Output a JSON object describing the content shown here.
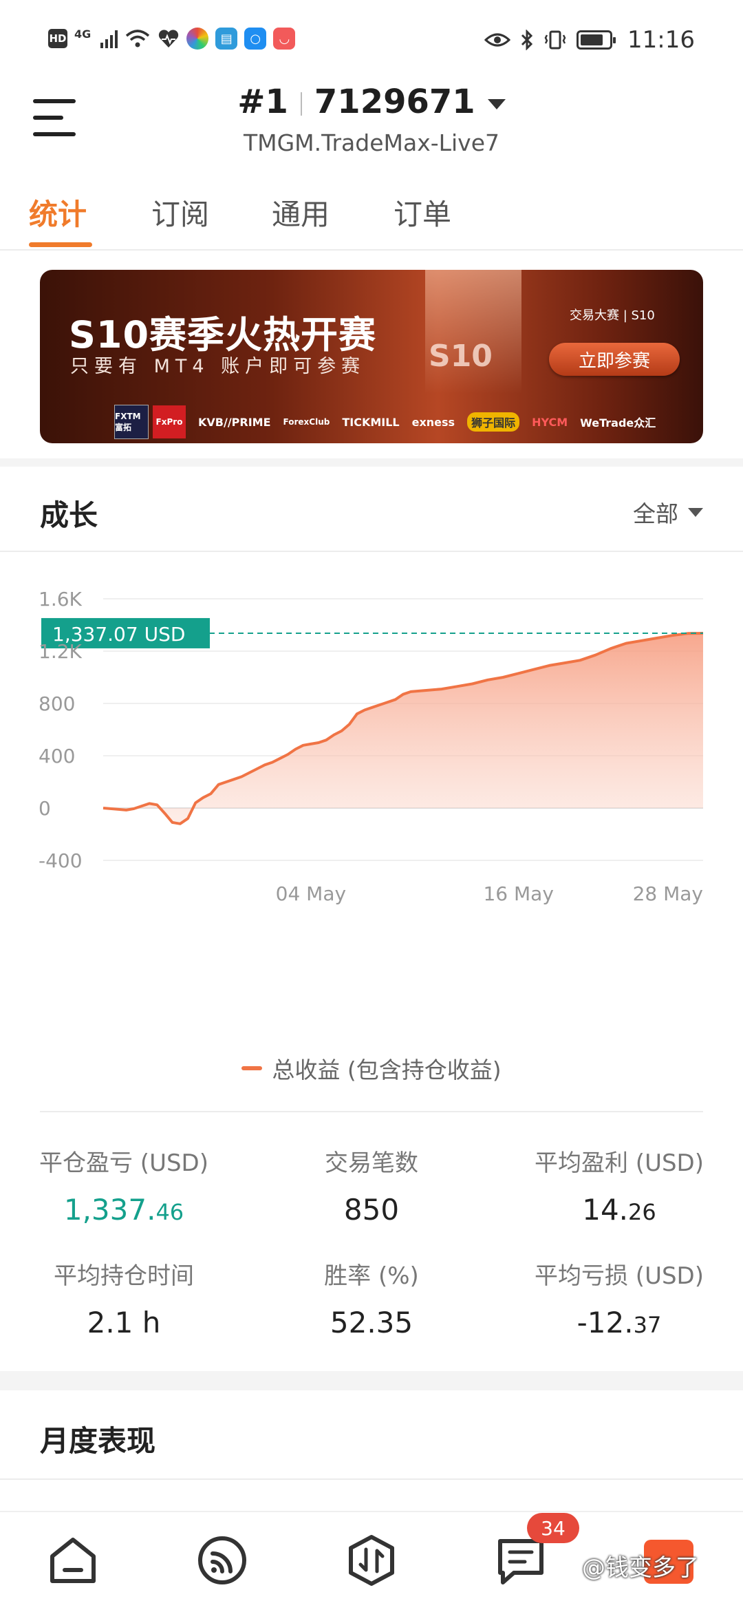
{
  "status_bar": {
    "hd": "HD",
    "network": "4G",
    "time": "11:16"
  },
  "header": {
    "account_rank": "#1",
    "account_id": "7129671",
    "server": "TMGM.TradeMax-Live7"
  },
  "tabs": [
    {
      "label": "统计",
      "active": true
    },
    {
      "label": "订阅",
      "active": false
    },
    {
      "label": "通用",
      "active": false
    },
    {
      "label": "订单",
      "active": false
    }
  ],
  "banner": {
    "title": "S10赛季火热开赛",
    "subtitle": "只要有 MT4 账户即可参赛",
    "season_mark": "S10",
    "brand": "交易大赛 | S10",
    "cta_label": "立即参赛",
    "sponsors": [
      "FXTM 富拓",
      "FxPro",
      "KVB//PRIME",
      "ForexClub",
      "TICKMILL",
      "exness",
      "狮子国际",
      "HYCM",
      "WeTrade众汇"
    ]
  },
  "growth": {
    "title": "成长",
    "range_filter": "全部",
    "current_value_label": "1,337.07 USD",
    "legend_label": "总收益 (包含持仓收益)"
  },
  "chart_data": {
    "type": "area",
    "y_ticks": [
      "1.6K",
      "1.2K",
      "800",
      "400",
      "0",
      "-400"
    ],
    "x_ticks": [
      "04 May",
      "16 May",
      "28 May"
    ],
    "ylim": [
      -400,
      1600
    ],
    "current_value": 1337.07,
    "series": [
      {
        "name": "总收益 (包含持仓收益)",
        "color": "#f07445",
        "points": [
          [
            0,
            0
          ],
          [
            2,
            -10
          ],
          [
            3,
            -15
          ],
          [
            4,
            -5
          ],
          [
            5,
            15
          ],
          [
            6,
            35
          ],
          [
            7,
            25
          ],
          [
            8,
            -40
          ],
          [
            9,
            -110
          ],
          [
            10,
            -120
          ],
          [
            11,
            -80
          ],
          [
            12,
            40
          ],
          [
            13,
            80
          ],
          [
            14,
            110
          ],
          [
            15,
            180
          ],
          [
            16,
            200
          ],
          [
            17,
            220
          ],
          [
            18,
            240
          ],
          [
            20,
            300
          ],
          [
            21,
            330
          ],
          [
            22,
            350
          ],
          [
            23,
            380
          ],
          [
            24,
            410
          ],
          [
            25,
            450
          ],
          [
            26,
            480
          ],
          [
            27,
            490
          ],
          [
            28,
            500
          ],
          [
            29,
            520
          ],
          [
            30,
            560
          ],
          [
            31,
            590
          ],
          [
            32,
            640
          ],
          [
            33,
            720
          ],
          [
            34,
            750
          ],
          [
            35,
            770
          ],
          [
            36,
            790
          ],
          [
            37,
            810
          ],
          [
            38,
            830
          ],
          [
            39,
            870
          ],
          [
            40,
            890
          ],
          [
            42,
            900
          ],
          [
            44,
            910
          ],
          [
            46,
            930
          ],
          [
            48,
            950
          ],
          [
            50,
            980
          ],
          [
            52,
            1000
          ],
          [
            54,
            1030
          ],
          [
            56,
            1060
          ],
          [
            58,
            1090
          ],
          [
            60,
            1110
          ],
          [
            62,
            1130
          ],
          [
            64,
            1170
          ],
          [
            66,
            1220
          ],
          [
            68,
            1260
          ],
          [
            70,
            1280
          ],
          [
            72,
            1300
          ],
          [
            74,
            1320
          ],
          [
            76,
            1335
          ],
          [
            78,
            1337.07
          ]
        ]
      }
    ],
    "x_range_days": [
      0,
      78
    ]
  },
  "stats": [
    {
      "label": "平仓盈亏 (USD)",
      "main": "1,337.",
      "fraction": "46",
      "positive": true
    },
    {
      "label": "交易笔数",
      "main": "850",
      "fraction": "",
      "positive": false
    },
    {
      "label": "平均盈利 (USD)",
      "main": "14.",
      "fraction": "26",
      "positive": false
    },
    {
      "label": "平均持仓时间",
      "main": "2.1 h",
      "fraction": "",
      "positive": false
    },
    {
      "label": "胜率 (%)",
      "main": "52.35",
      "fraction": "",
      "positive": false
    },
    {
      "label": "平均亏损 (USD)",
      "main": "-12.",
      "fraction": "37",
      "positive": false
    }
  ],
  "monthly": {
    "title": "月度表现"
  },
  "bottom_nav": {
    "items": [
      "home-icon",
      "feed-icon",
      "trade-icon",
      "messages-icon",
      "profile-icon"
    ],
    "message_badge": "34",
    "watermark": "@钱变多了"
  },
  "colors": {
    "accent": "#f07b2b",
    "positive": "#14a08c",
    "series": "#f07445",
    "badge": "#e6493b"
  }
}
